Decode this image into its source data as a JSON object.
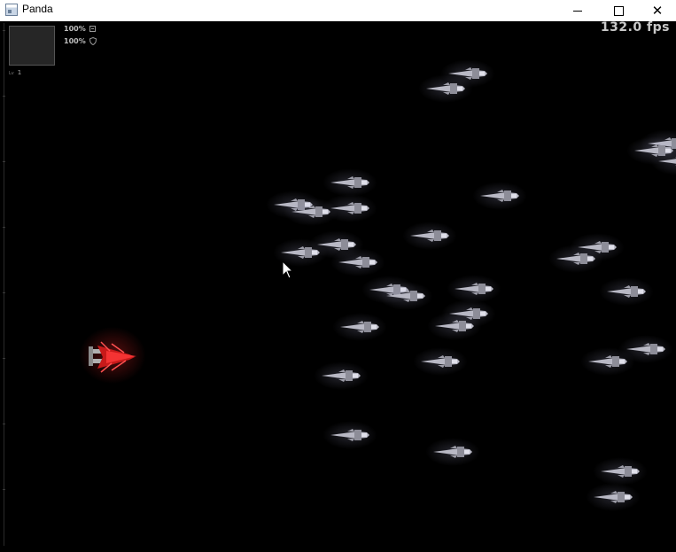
{
  "window": {
    "title": "Panda",
    "icon": "app-window-icon",
    "controls": {
      "minimize": "minimize-icon",
      "maximize": "maximize-icon",
      "close": "close-icon"
    }
  },
  "hud": {
    "health": {
      "value": "100%",
      "icon": "health-icon"
    },
    "shield": {
      "value": "100%",
      "icon": "shield-icon"
    },
    "level": {
      "label": "Lv",
      "value": "1"
    },
    "minimap": "minimap",
    "fps": "132.0 fps"
  },
  "scene": {
    "background": "#000000",
    "player": {
      "type": "player-ship",
      "glow_color": "#ff2020"
    },
    "enemies": {
      "type": "enemy-ship",
      "count": 31,
      "color": "#b8b8c4"
    }
  }
}
